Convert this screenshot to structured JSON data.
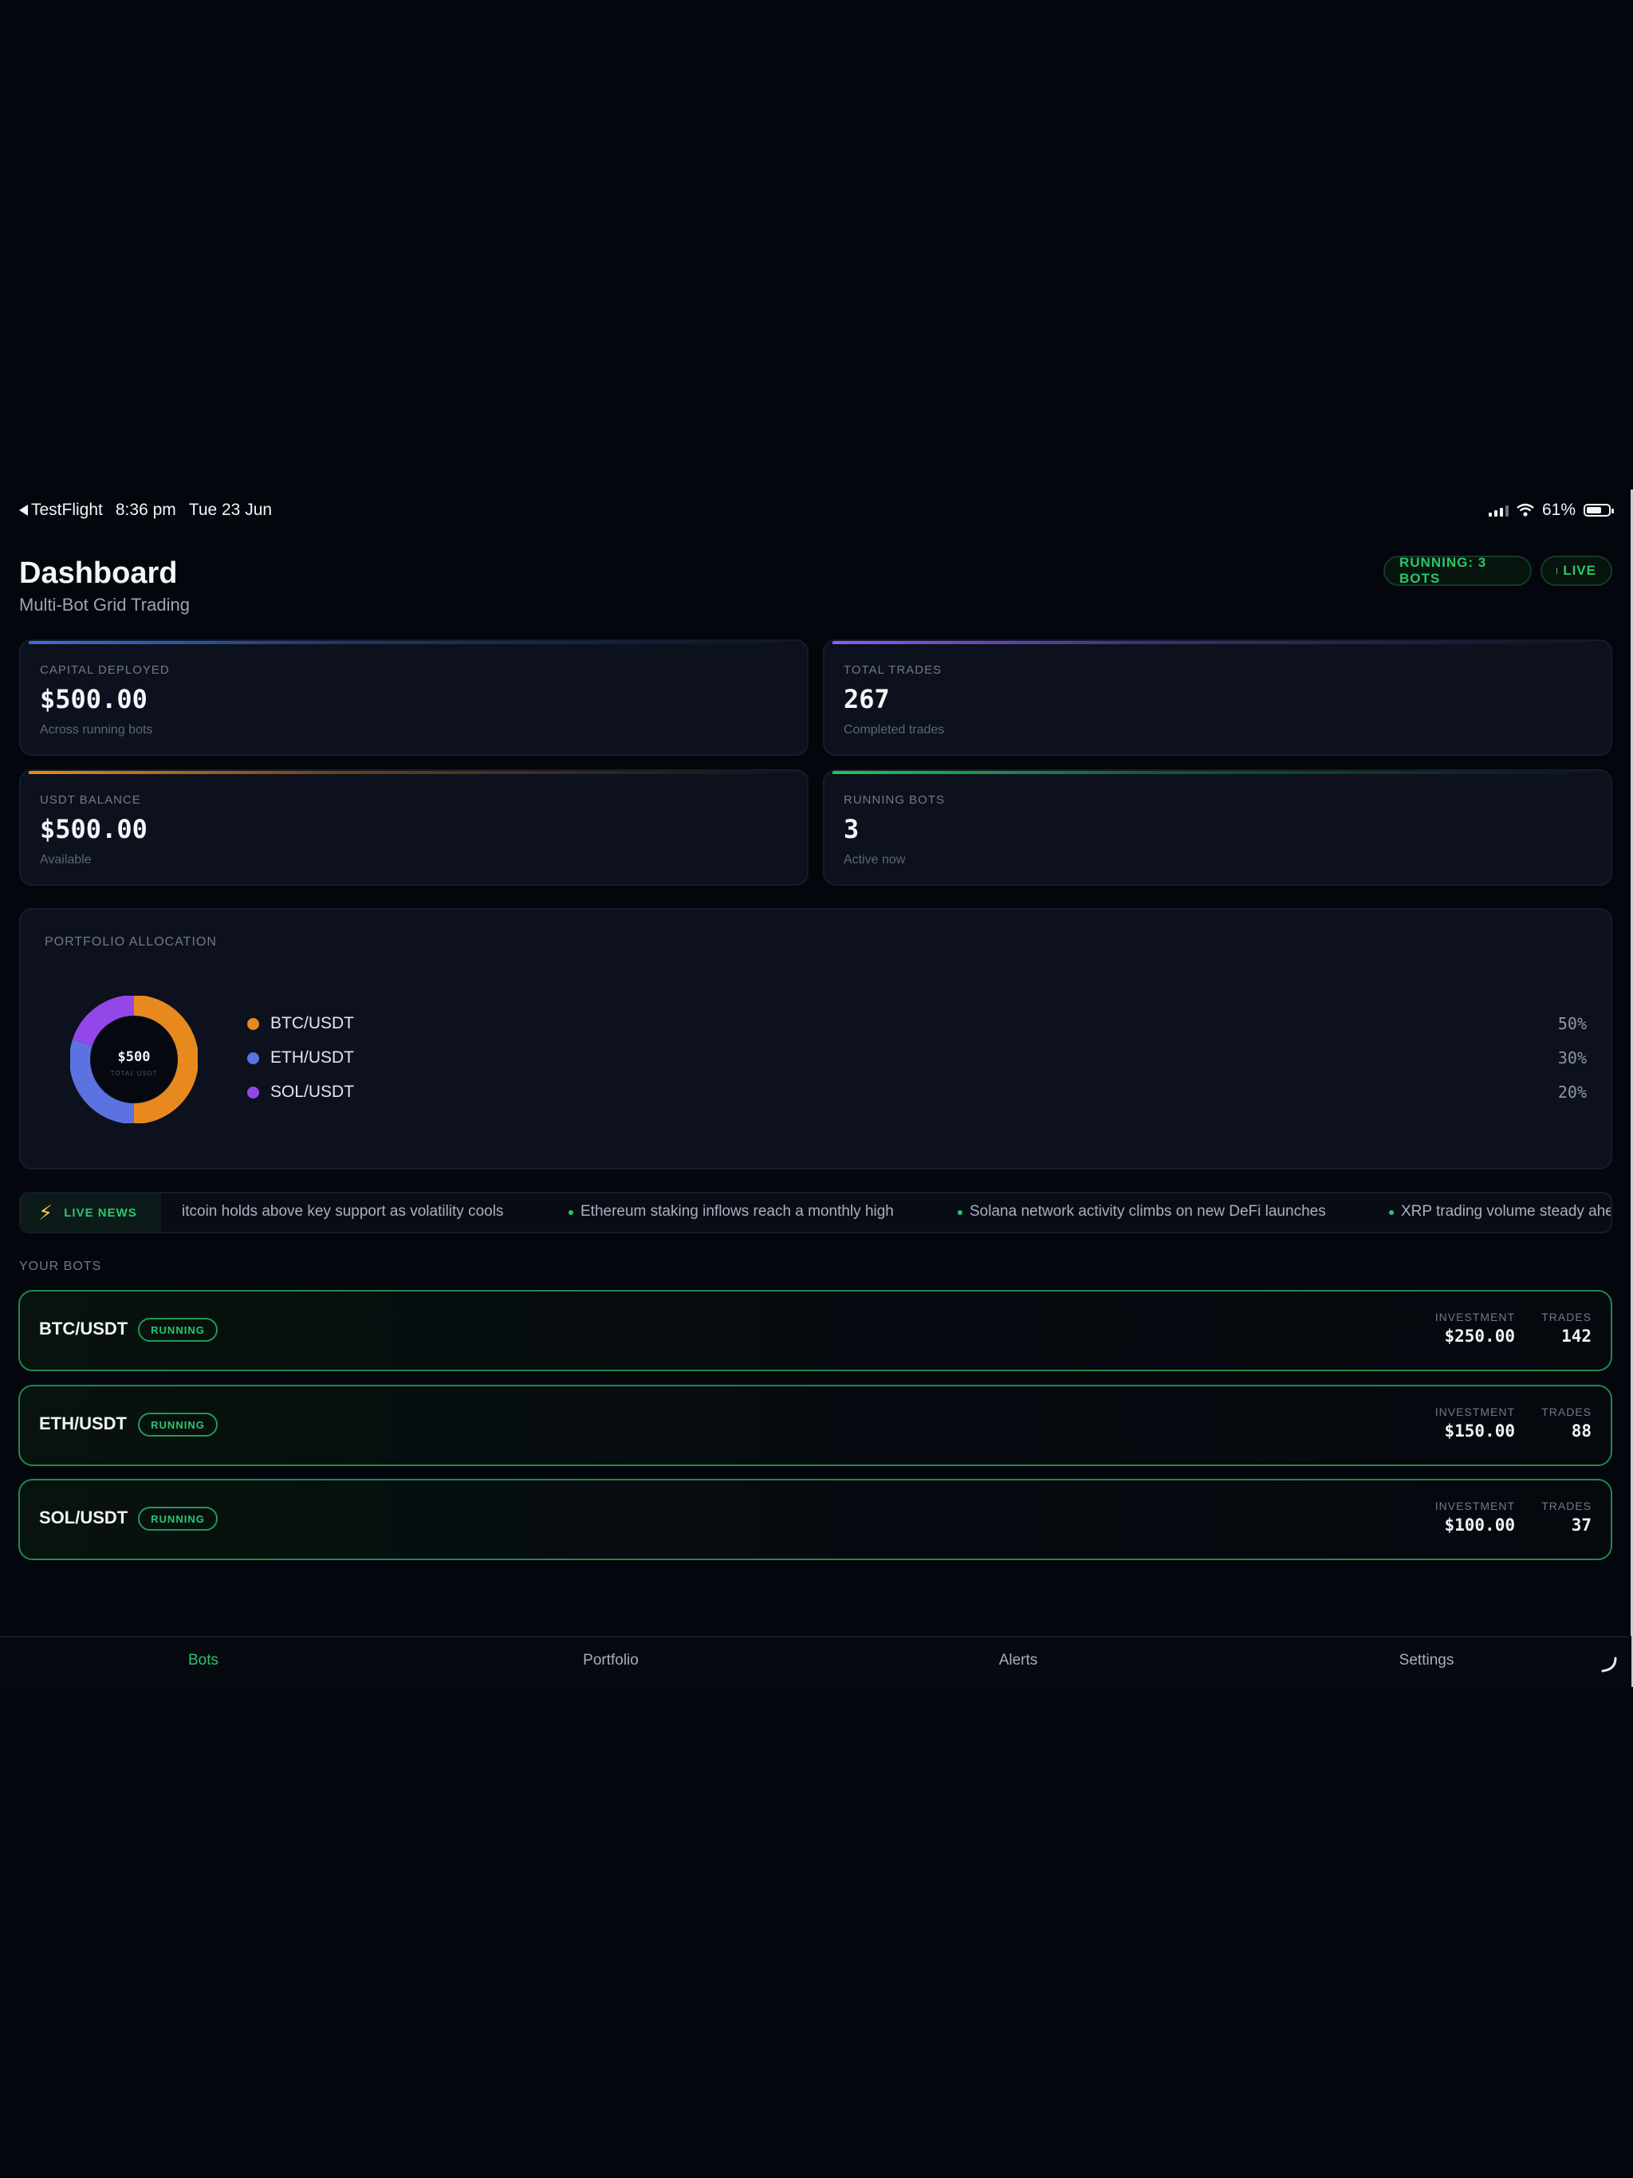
{
  "status_bar": {
    "back_app": "TestFlight",
    "time": "8:36 pm",
    "date": "Tue 23 Jun",
    "battery": "61%"
  },
  "header": {
    "title": "Dashboard",
    "subtitle": "Multi-Bot Grid Trading",
    "running_badge": "RUNNING: 3 BOTS",
    "live_badge": "LIVE"
  },
  "stats": [
    {
      "label": "CAPITAL DEPLOYED",
      "value": "$500.00",
      "sub": "Across running bots",
      "accent": "#3b6fd8"
    },
    {
      "label": "TOTAL TRADES",
      "value": "267",
      "sub": "Completed trades",
      "accent": "#8b5cf6"
    },
    {
      "label": "USDT BALANCE",
      "value": "$500.00",
      "sub": "Available",
      "accent": "#e8891f"
    },
    {
      "label": "RUNNING BOTS",
      "value": "3",
      "sub": "Active now",
      "accent": "#22c55e"
    }
  ],
  "portfolio": {
    "label": "PORTFOLIO ALLOCATION",
    "center_value": "$500",
    "center_label": "TOTAL USDT",
    "items": [
      {
        "name": "BTC/USDT",
        "percent": "50%",
        "value": 50,
        "color": "#e8891f"
      },
      {
        "name": "ETH/USDT",
        "percent": "30%",
        "value": 30,
        "color": "#5b72e0"
      },
      {
        "name": "SOL/USDT",
        "percent": "20%",
        "value": 20,
        "color": "#9347e8"
      }
    ]
  },
  "news": {
    "label": "LIVE NEWS",
    "items": [
      "itcoin holds above key support as volatility cools",
      "Ethereum staking inflows reach a monthly high",
      "Solana network activity climbs on new DeFi launches",
      "XRP trading volume steady ahead"
    ]
  },
  "bots_section": "YOUR BOTS",
  "bots": [
    {
      "pair": "BTC/USDT",
      "status": "RUNNING",
      "investment_label": "INVESTMENT",
      "investment": "$250.00",
      "trades_label": "TRADES",
      "trades": "142"
    },
    {
      "pair": "ETH/USDT",
      "status": "RUNNING",
      "investment_label": "INVESTMENT",
      "investment": "$150.00",
      "trades_label": "TRADES",
      "trades": "88"
    },
    {
      "pair": "SOL/USDT",
      "status": "RUNNING",
      "investment_label": "INVESTMENT",
      "investment": "$100.00",
      "trades_label": "TRADES",
      "trades": "37"
    }
  ],
  "tabs": [
    {
      "label": "Bots",
      "active": true
    },
    {
      "label": "Portfolio",
      "active": false
    },
    {
      "label": "Alerts",
      "active": false
    },
    {
      "label": "Settings",
      "active": false
    }
  ],
  "colors": {
    "accent_green": "#28c76a",
    "background": "#04060d",
    "card": "#0c111d"
  }
}
